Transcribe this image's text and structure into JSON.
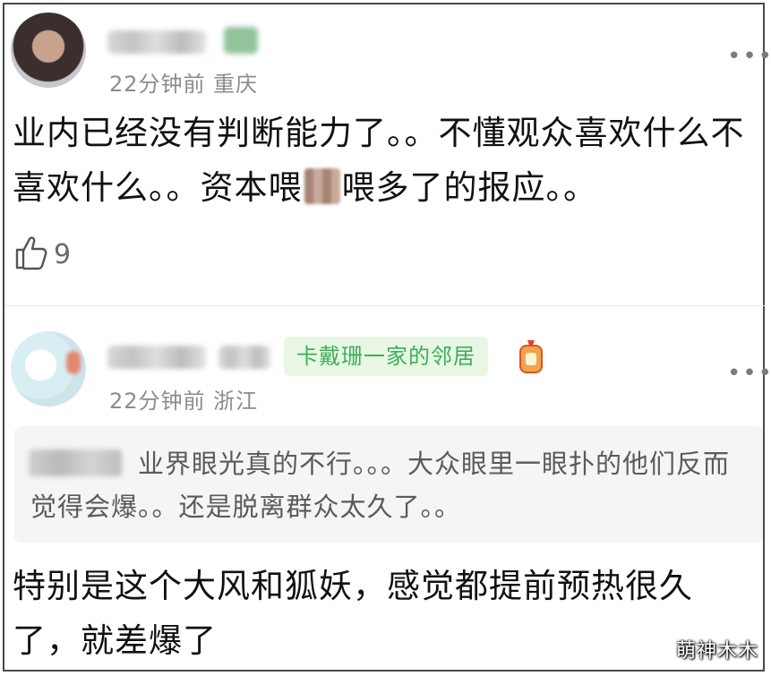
{
  "comments": [
    {
      "meta": "22分钟前  重庆",
      "text_part1": "业内已经没有判断能力了。。不懂观众喜欢什么不喜欢什么。。资本喂",
      "text_part2": "喂多了的报应。。",
      "like_count": "9"
    },
    {
      "badge": "卡戴珊一家的邻居",
      "meta": "22分钟前  浙江",
      "quote": "业界眼光真的不行。。。大众眼里一眼扑的他们反而觉得会爆。。还是脱离群众太久了。。",
      "text": "特别是这个大风和狐妖，感觉都提前预热很久了，就差爆了"
    }
  ],
  "watermark": "萌神木木",
  "colors": {
    "badge_bg": "#e7f7e4",
    "badge_text": "#3eae5a",
    "meta": "#8c8c8c"
  }
}
